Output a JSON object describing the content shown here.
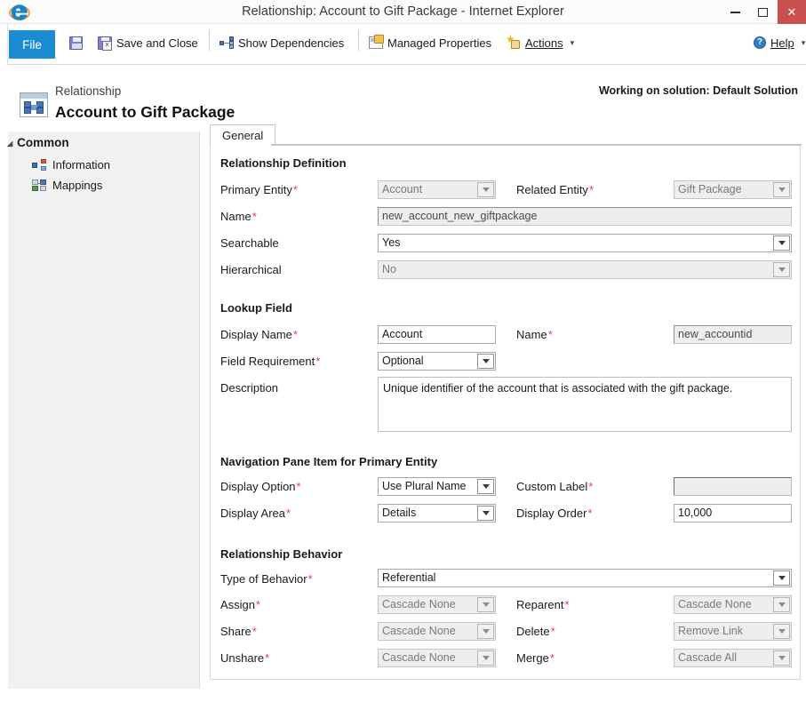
{
  "window": {
    "title": "Relationship: Account to Gift Package - Internet Explorer",
    "app_icon": "internet-explorer-icon",
    "minimize": "—",
    "maximize": "◻",
    "close": "✕",
    "close_color": "#c9504e"
  },
  "ribbon": {
    "file_label": "File",
    "file_color": "#1b8cd1",
    "save_icon": "save-icon",
    "save_and_close_label": "Save and Close",
    "save_and_close_icon": "save-and-close-icon",
    "show_dependencies_label": "Show Dependencies",
    "show_dependencies_icon": "dependencies-icon",
    "managed_properties_label": "Managed Properties",
    "managed_properties_icon": "managed-properties-icon",
    "actions_label": "Actions",
    "actions_icon": "actions-star-icon",
    "actions_caret": "▾",
    "help_label": "Help",
    "help_icon": "help-circle-icon",
    "help_caret": "▾"
  },
  "header": {
    "entity_icon": "relationship-entity-icon",
    "subtitle": "Relationship",
    "title": "Account to Gift Package",
    "solution_note": "Working on solution: Default Solution"
  },
  "sidebar": {
    "group_label": "Common",
    "group_arrow": "◢",
    "items": [
      {
        "label": "Information",
        "icon": "information-nodes-icon"
      },
      {
        "label": "Mappings",
        "icon": "mappings-icon"
      }
    ]
  },
  "tabs": [
    {
      "label": "General",
      "active": true
    }
  ],
  "form": {
    "sections": {
      "relationship_definition": {
        "title": "Relationship Definition",
        "primary_entity": {
          "label": "Primary Entity",
          "required": "*",
          "value": "Account",
          "control": "select",
          "disabled": true
        },
        "related_entity": {
          "label": "Related Entity",
          "required": "*",
          "value": "Gift Package",
          "control": "select",
          "disabled": true
        },
        "name": {
          "label": "Name",
          "required": "*",
          "value": "new_account_new_giftpackage",
          "control": "text",
          "readonly": true
        },
        "searchable": {
          "label": "Searchable",
          "required": "",
          "value": "Yes",
          "control": "select",
          "disabled": false
        },
        "hierarchical": {
          "label": "Hierarchical",
          "required": "",
          "value": "No",
          "control": "select",
          "disabled": true
        }
      },
      "lookup_field": {
        "title": "Lookup Field",
        "display_name": {
          "label": "Display Name",
          "required": "*",
          "value": "Account",
          "control": "text",
          "disabled": false
        },
        "name": {
          "label": "Name",
          "required": "*",
          "value": "new_accountid",
          "control": "text",
          "readonly": true
        },
        "field_requirement": {
          "label": "Field Requirement",
          "required": "*",
          "value": "Optional",
          "control": "select",
          "disabled": false
        },
        "description": {
          "label": "Description",
          "required": "",
          "value": "Unique identifier of the account that is associated with the gift package.",
          "control": "textarea"
        }
      },
      "navigation_pane": {
        "title": "Navigation Pane Item for Primary Entity",
        "display_option": {
          "label": "Display Option",
          "required": "*",
          "value": "Use Plural Name",
          "control": "select",
          "disabled": false
        },
        "custom_label": {
          "label": "Custom Label",
          "required": "*",
          "value": "",
          "control": "text",
          "disabled": true
        },
        "display_area": {
          "label": "Display Area",
          "required": "*",
          "value": "Details",
          "control": "select",
          "disabled": false
        },
        "display_order": {
          "label": "Display Order",
          "required": "*",
          "value": "10,000",
          "control": "text",
          "disabled": false
        }
      },
      "relationship_behavior": {
        "title": "Relationship Behavior",
        "type_of_behavior": {
          "label": "Type of Behavior",
          "required": "*",
          "value": "Referential",
          "control": "select",
          "disabled": false
        },
        "assign": {
          "label": "Assign",
          "required": "*",
          "value": "Cascade None",
          "control": "select",
          "disabled": true
        },
        "reparent": {
          "label": "Reparent",
          "required": "*",
          "value": "Cascade None",
          "control": "select",
          "disabled": true
        },
        "share": {
          "label": "Share",
          "required": "*",
          "value": "Cascade None",
          "control": "select",
          "disabled": true
        },
        "delete": {
          "label": "Delete",
          "required": "*",
          "value": "Remove Link",
          "control": "select",
          "disabled": true
        },
        "unshare": {
          "label": "Unshare",
          "required": "*",
          "value": "Cascade None",
          "control": "select",
          "disabled": true
        },
        "merge": {
          "label": "Merge",
          "required": "*",
          "value": "Cascade All",
          "control": "select",
          "disabled": true
        }
      }
    }
  }
}
